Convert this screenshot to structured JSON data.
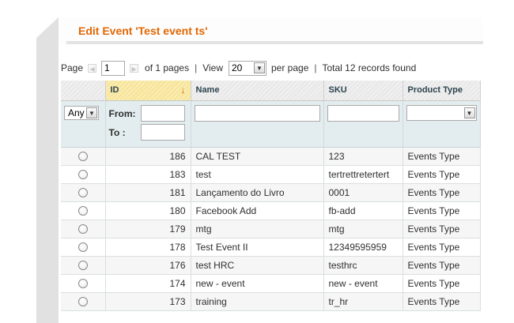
{
  "title": "Edit Event 'Test event ts'",
  "pager": {
    "page_label": "Page",
    "page_value": "1",
    "of_pages": "of 1 pages",
    "separator": "|",
    "view_label": "View",
    "view_value": "20",
    "per_page": "per page",
    "total": "Total 12 records found"
  },
  "columns": [
    "ID",
    "Name",
    "SKU",
    "Product Type"
  ],
  "filter": {
    "any_value": "Any",
    "from_label": "From:",
    "to_label": "To :"
  },
  "rows": [
    {
      "id": "186",
      "name": "CAL TEST",
      "sku": "123",
      "type": "Events Type"
    },
    {
      "id": "183",
      "name": "test",
      "sku": "tertrettretertert",
      "type": "Events Type"
    },
    {
      "id": "181",
      "name": "Lançamento do Livro",
      "sku": "0001",
      "type": "Events Type"
    },
    {
      "id": "180",
      "name": "Facebook Add",
      "sku": "fb-add",
      "type": "Events Type"
    },
    {
      "id": "179",
      "name": "mtg",
      "sku": "mtg",
      "type": "Events Type"
    },
    {
      "id": "178",
      "name": "Test Event II",
      "sku": "12349595959",
      "type": "Events Type"
    },
    {
      "id": "176",
      "name": "test HRC",
      "sku": "testhrc",
      "type": "Events Type"
    },
    {
      "id": "174",
      "name": "new - event",
      "sku": "new - event",
      "type": "Events Type"
    },
    {
      "id": "173",
      "name": "training",
      "sku": "tr_hr",
      "type": "Events Type"
    }
  ],
  "colors": {
    "accent": "#e26703",
    "header_bg": "#e9e9e9",
    "filter_bg": "#e3ecee",
    "sorted_bg": "#f7e59a"
  }
}
